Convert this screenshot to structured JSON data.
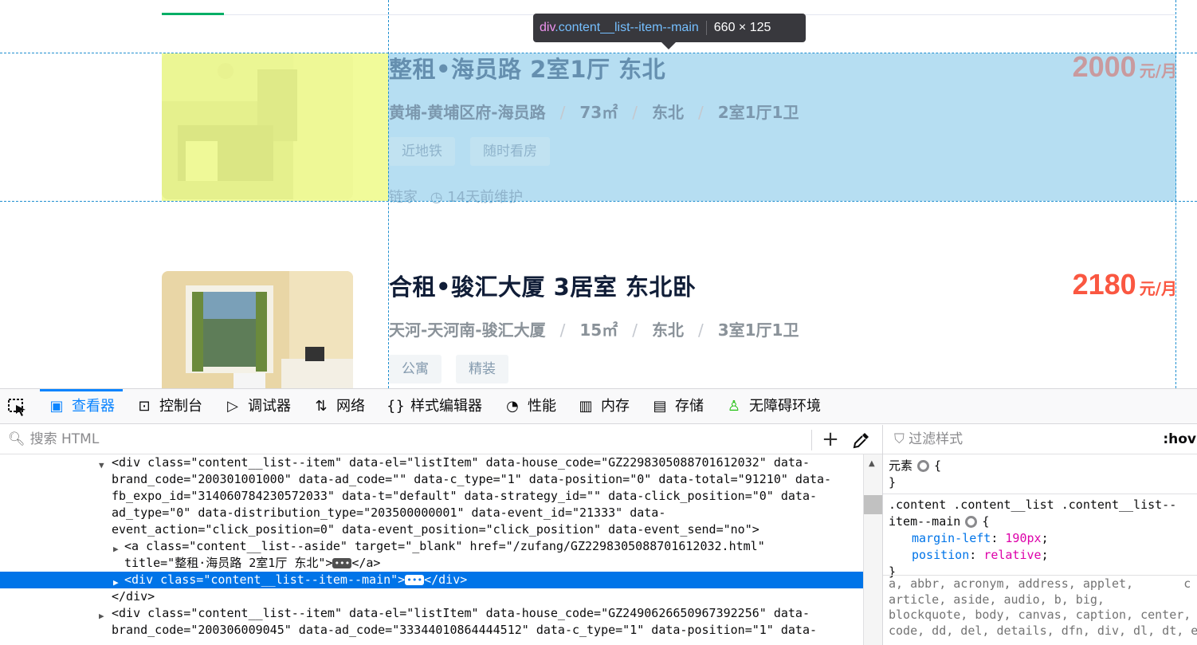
{
  "listings": [
    {
      "title": "整租•海员路 2室1厅 东北",
      "price": "2000",
      "price_unit": "元/月",
      "location": "黄埔-黄埔区府-海员路",
      "area": "73㎡",
      "orientation": "东北",
      "layout": "2室1厅1卫",
      "tags": [
        "近地铁",
        "随时看房"
      ],
      "brand": "链家",
      "maintained": "14天前维护"
    },
    {
      "title": "合租•骏汇大厦 3居室 东北卧",
      "price": "2180",
      "price_unit": "元/月",
      "location": "天河-天河南-骏汇大厦",
      "area": "15㎡",
      "orientation": "东北",
      "layout": "3室1厅1卫",
      "tags": [
        "公寓",
        "精装"
      ]
    }
  ],
  "separator": "/",
  "tooltip": {
    "tag": "div",
    "class": ".content__list--item--main",
    "size": "660 × 125"
  },
  "devtools": {
    "tabs": [
      {
        "label": "查看器",
        "icon": "inspector-icon"
      },
      {
        "label": "控制台",
        "icon": "console-icon"
      },
      {
        "label": "调试器",
        "icon": "debugger-icon"
      },
      {
        "label": "网络",
        "icon": "network-icon"
      },
      {
        "label": "样式编辑器",
        "icon": "style-editor-icon"
      },
      {
        "label": "性能",
        "icon": "performance-icon"
      },
      {
        "label": "内存",
        "icon": "memory-icon"
      },
      {
        "label": "存储",
        "icon": "storage-icon"
      },
      {
        "label": "无障碍环境",
        "icon": "accessibility-icon"
      }
    ],
    "active_tab": "查看器",
    "search_placeholder": "搜索 HTML",
    "filter_placeholder": "过滤样式",
    "hov_label": ":hov",
    "markup_lines": [
      "<div class=\"content__list--item\" data-el=\"listItem\" data-house_code=\"GZ2298305088701612032\" data-",
      "brand_code=\"200301001000\" data-ad_code=\"\" data-c_type=\"1\" data-position=\"0\" data-total=\"91210\" data-",
      "fb_expo_id=\"314060784230572033\" data-t=\"default\" data-strategy_id=\"\" data-click_position=\"0\" data-",
      "ad_type=\"0\" data-distribution_type=\"203500000001\" data-event_id=\"21333\" data-",
      "event_action=\"click_position=0\" data-event_position=\"click_position\" data-event_send=\"no\">",
      "<a class=\"content__list--aside\" target=\"_blank\" href=\"/zufang/GZ2298305088701612032.html\"",
      "title=\"整租·海员路 2室1厅 东北\">",
      "<div class=\"content__list--item--main\">",
      "</div>",
      "<div class=\"content__list--item\" data-el=\"listItem\" data-house_code=\"GZ2490626650967392256\" data-",
      "brand_code=\"200306009045\" data-ad_code=\"33344010864444512\" data-c_type=\"1\" data-position=\"1\" data-"
    ],
    "ellipsis": "•••",
    "close_a": "</a>",
    "close_div": "</div>",
    "rules": {
      "element_selector": "元素",
      "open_brace": "{",
      "close_brace": "}",
      "selector_line1": ".content .content__list .content__list--",
      "selector_line2": "item--main",
      "declarations": [
        {
          "prop": "margin-left",
          "value": "190px"
        },
        {
          "prop": "position",
          "value": "relative"
        }
      ],
      "inherited_lines": [
        "a, abbr, acronym, address, applet,       c",
        "article, aside, audio, b, big,",
        "blockquote, body, canvas, caption, center,",
        "code, dd, del, details, dfn, div, dl, dt, e"
      ]
    }
  }
}
